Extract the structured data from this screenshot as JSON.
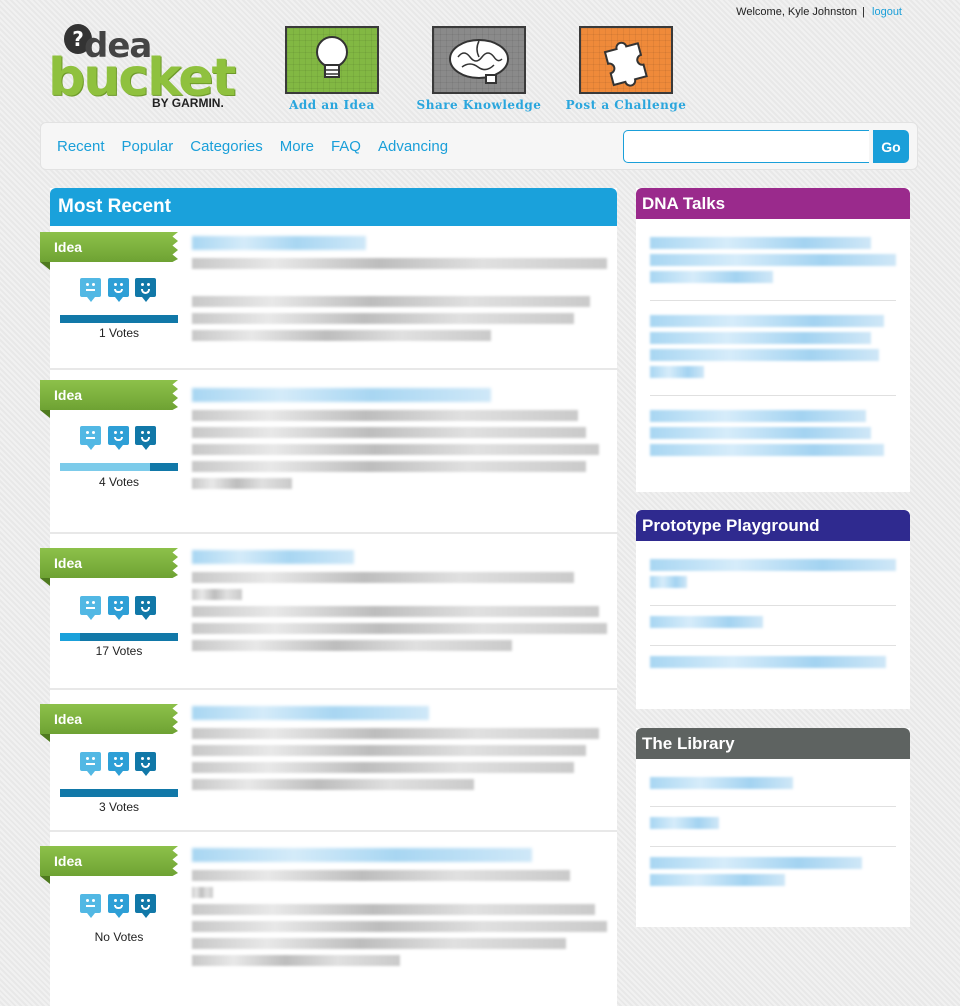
{
  "header": {
    "welcome": "Welcome, Kyle Johnston",
    "separator": "|",
    "logout": "logout",
    "logo": {
      "idea": "dea",
      "bucket": "bucket",
      "by": "BY GARMIN."
    }
  },
  "tiles": [
    {
      "label": "Add an Idea",
      "color": "#82b843",
      "icon": "lightbulb-icon"
    },
    {
      "label": "Share Knowledge",
      "color": "#8a8a8a",
      "icon": "brain-icon"
    },
    {
      "label": "Post a Challenge",
      "color": "#ef8a3a",
      "icon": "puzzle-icon"
    }
  ],
  "nav": {
    "links": [
      "Recent",
      "Popular",
      "Categories",
      "More",
      "FAQ",
      "Advancing"
    ],
    "search_placeholder": "",
    "search_button": "Go"
  },
  "main": {
    "title": "Most Recent",
    "items": [
      {
        "tag": "Idea",
        "votes": "1 Votes",
        "bar_fill": 0.0
      },
      {
        "tag": "Idea",
        "votes": "4 Votes",
        "bar_fill": 0.76
      },
      {
        "tag": "Idea",
        "votes": "17 Votes",
        "bar_fill": 0.17
      },
      {
        "tag": "Idea",
        "votes": "3 Votes",
        "bar_fill": 0.0
      },
      {
        "tag": "Idea",
        "votes": "No Votes",
        "bar_fill": null
      }
    ]
  },
  "sidebar": {
    "dna": {
      "title": "DNA Talks",
      "color": "#9a2a8c"
    },
    "proto": {
      "title": "Prototype Playground",
      "color": "#2f2a8f"
    },
    "library": {
      "title": "The Library",
      "color": "#5e6361"
    }
  },
  "colors": {
    "accent": "#1aa1db",
    "idea_green": "#7cb23d"
  }
}
